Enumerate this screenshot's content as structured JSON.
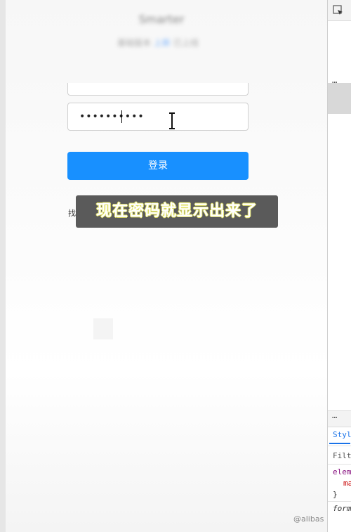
{
  "header": {
    "title_blurred": "Smarter",
    "subtitle_part1": "基础版本",
    "subtitle_part2": "上新",
    "subtitle_part3": "已上线"
  },
  "login_form": {
    "password_value": "••••••••••",
    "login_button_label": "登录",
    "link_partial": "找"
  },
  "caption": {
    "text": "现在密码就显示出来了"
  },
  "devtools": {
    "dots_top": "⋯",
    "dots_bottom": "⋯",
    "styles_tab": "Styles",
    "filter_placeholder": "Filter",
    "element_line": "element.style {",
    "prop_line": "ma",
    "close_brace": "}",
    "form_line": "form"
  },
  "watermark": {
    "text": "@alibas"
  }
}
